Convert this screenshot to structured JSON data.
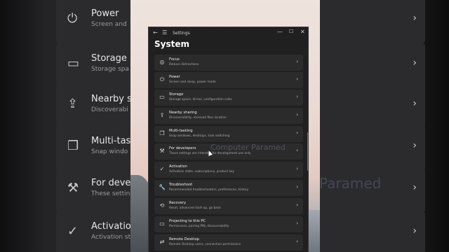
{
  "window": {
    "app_title": "Settings",
    "back_icon": "back-arrow-icon",
    "menu_icon": "hamburger-icon",
    "page_title": "System",
    "min_label": "—",
    "max_label": "☐",
    "close_label": "✕"
  },
  "items": [
    {
      "title": "Focus",
      "subtitle": "Reduce distractions",
      "icon": "focus-icon",
      "glyph": "◎"
    },
    {
      "title": "Power",
      "subtitle": "Screen and sleep, power mode",
      "icon": "power-icon",
      "glyph": "⏻"
    },
    {
      "title": "Storage",
      "subtitle": "Storage space, drives, configuration rules",
      "icon": "storage-icon",
      "glyph": "▭"
    },
    {
      "title": "Nearby sharing",
      "subtitle": "Discoverability, received files location",
      "icon": "nearby-sharing-icon",
      "glyph": "⇪"
    },
    {
      "title": "Multi-tasking",
      "subtitle": "Snap windows, desktops, task switching",
      "icon": "multitasking-icon",
      "glyph": "❐"
    },
    {
      "title": "For developers",
      "subtitle": "These settings are intended for development use only",
      "icon": "developers-icon",
      "glyph": "⚒"
    },
    {
      "title": "Activation",
      "subtitle": "Activation state, subscriptions, product key",
      "icon": "activation-icon",
      "glyph": "✓"
    },
    {
      "title": "Troubleshoot",
      "subtitle": "Recommended troubleshooters, preferences, history",
      "icon": "troubleshoot-icon",
      "glyph": "🔧"
    },
    {
      "title": "Recovery",
      "subtitle": "Reset, advanced start-up, go back",
      "icon": "recovery-icon",
      "glyph": "⟲"
    },
    {
      "title": "Projecting to this PC",
      "subtitle": "Permissions, pairing PIN, discoverability",
      "icon": "projecting-icon",
      "glyph": "▭"
    },
    {
      "title": "Remote Desktop",
      "subtitle": "Remote Desktop users, connection permissions",
      "icon": "remote-desktop-icon",
      "glyph": "⇄"
    }
  ],
  "background_left": [
    {
      "title": "Power",
      "subtitle": "Screen and",
      "glyph": "⏻"
    },
    {
      "title": "Storage",
      "subtitle": "Storage spa",
      "glyph": "▭"
    },
    {
      "title": "Nearby sha",
      "subtitle": "Discoverabi",
      "glyph": "⇪"
    },
    {
      "title": "Multi-task",
      "subtitle": "Snap windo",
      "glyph": "❐"
    },
    {
      "title": "For develo",
      "subtitle": "These settin",
      "glyph": "⚒"
    },
    {
      "title": "Activation",
      "subtitle": "Activation st",
      "glyph": "✓"
    }
  ],
  "watermark": {
    "line1": "Computer Paramed",
    "line2": "Paramed"
  },
  "chevron": "›"
}
